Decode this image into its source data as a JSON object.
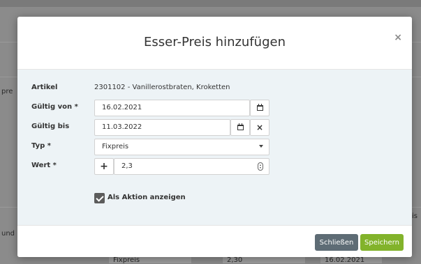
{
  "background": {
    "fragments": [
      "pre",
      "und",
      "is"
    ],
    "row_cells": [
      "Fixpreis",
      "2,30",
      "16.02.2021"
    ]
  },
  "modal": {
    "title": "Esser-Preis hinzufügen",
    "close_glyph": "×"
  },
  "form": {
    "artikel": {
      "label": "Artikel",
      "value": "2301102 - Vanillerostbraten, Kroketten"
    },
    "gueltig_von": {
      "label": "Gültig von *",
      "value": "16.02.2021"
    },
    "gueltig_bis": {
      "label": "Gültig bis",
      "value": "11.03.2022"
    },
    "typ": {
      "label": "Typ *",
      "value": "Fixpreis"
    },
    "wert": {
      "label": "Wert *",
      "value": "2,3",
      "plus": "+"
    },
    "aktion": {
      "label": "Als Aktion anzeigen",
      "checked": true
    }
  },
  "icons": {
    "clear": "×"
  },
  "footer": {
    "close_label": "Schließen",
    "save_label": "Speichern"
  },
  "colors": {
    "save": "#82b32b",
    "close": "#5e6c75",
    "body_bg": "#edf3f6"
  }
}
